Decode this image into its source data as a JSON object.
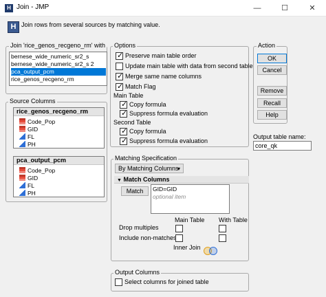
{
  "window": {
    "title": "Join - JMP",
    "app_icon": "H"
  },
  "header": {
    "icon": "H",
    "text": "Join rows from several sources by matching value."
  },
  "join_with": {
    "legend": "Join 'rice_genos_recgeno_rm' with",
    "items": [
      {
        "label": "bernese_wide_numeric_sr2_s",
        "selected": false
      },
      {
        "label": "bernese_wide_numeric_sr2_s 2",
        "selected": false
      },
      {
        "label": "pca_output_pcm",
        "selected": true
      },
      {
        "label": "rice_genos_recgeno_rm",
        "selected": false
      }
    ]
  },
  "source_columns": {
    "legend": "Source Columns",
    "table1": {
      "name": "rice_genos_recgeno_rm",
      "columns": [
        {
          "label": "Code_Pop",
          "icon": "nominal-icon"
        },
        {
          "label": "GID",
          "icon": "nominal-icon"
        },
        {
          "label": "FL",
          "icon": "continuous-icon"
        },
        {
          "label": "PH",
          "icon": "continuous-icon"
        }
      ]
    },
    "table2": {
      "name": "pca_output_pcm",
      "columns": [
        {
          "label": "Code_Pop",
          "icon": "nominal-icon"
        },
        {
          "label": "GID",
          "icon": "nominal-icon"
        },
        {
          "label": "FL",
          "icon": "continuous-icon"
        },
        {
          "label": "PH",
          "icon": "continuous-icon"
        }
      ]
    }
  },
  "options": {
    "legend": "Options",
    "preserve": "Preserve main table order",
    "update": "Update main table with data from second table",
    "merge": "Merge same name columns",
    "match_flag": "Match Flag",
    "main_table_label": "Main Table",
    "main_copy": "Copy formula",
    "main_suppress": "Suppress formula evaluation",
    "second_table_label": "Second Table",
    "second_copy": "Copy formula",
    "second_suppress": "Suppress formula evaluation"
  },
  "action": {
    "legend": "Action",
    "ok": "OK",
    "cancel": "Cancel",
    "remove": "Remove",
    "recall": "Recall",
    "help": "Help"
  },
  "output_table": {
    "label": "Output table name:",
    "value": "core_qk"
  },
  "matching": {
    "legend": "Matching Specification",
    "method": "By Matching Columns",
    "section": "Match Columns",
    "match_button": "Match",
    "pair": "GID=GID",
    "placeholder": "optional item",
    "main_table_col": "Main Table",
    "with_table_col": "With Table",
    "drop_multiples": "Drop multiples",
    "include_nonmatches": "Include non-matches",
    "inner_join": "Inner Join"
  },
  "output_columns": {
    "legend": "Output Columns",
    "select_cols": "Select columns for joined table"
  }
}
